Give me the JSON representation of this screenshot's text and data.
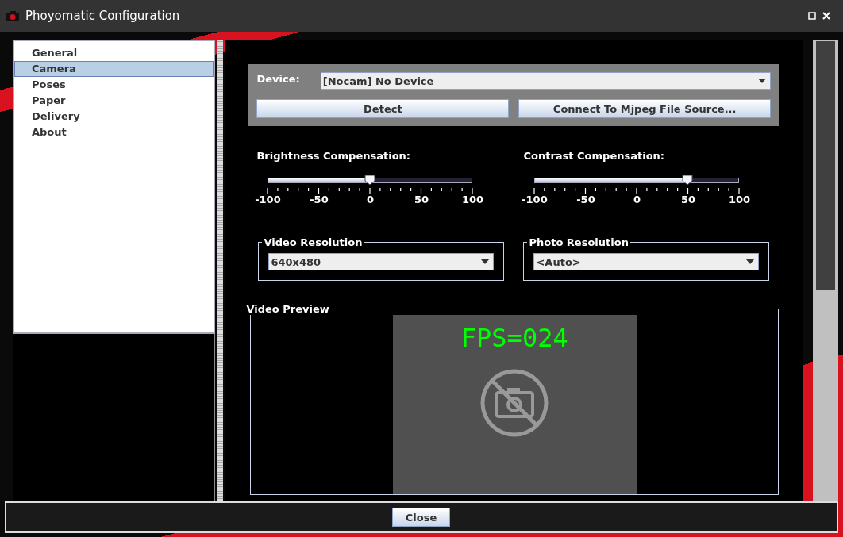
{
  "window": {
    "title": "Phoyomatic Configuration"
  },
  "sidebar": {
    "items": [
      {
        "label": "General",
        "selected": false
      },
      {
        "label": "Camera",
        "selected": true
      },
      {
        "label": "Poses",
        "selected": false
      },
      {
        "label": "Paper",
        "selected": false
      },
      {
        "label": "Delivery",
        "selected": false
      },
      {
        "label": "About",
        "selected": false
      }
    ]
  },
  "device": {
    "label": "Device:",
    "value": "[Nocam] No Device",
    "buttons": [
      "Detect",
      "Connect To Mjpeg File Source..."
    ]
  },
  "sliders": [
    {
      "label": "Brightness Compensation:",
      "level": 0.5,
      "ticks": [
        "-100",
        "-50",
        "0",
        "50",
        "100"
      ]
    },
    {
      "label": "Contrast Compensation:",
      "level": 0.75,
      "ticks": [
        "-100",
        "-50",
        "0",
        "50",
        "100"
      ]
    }
  ],
  "resolutions": [
    {
      "title": "Video Resolution",
      "value": "640x480"
    },
    {
      "title": "Photo Resolution",
      "value": "<Auto>"
    }
  ],
  "preview": {
    "title": "Video Preview",
    "fps": "FPS=024"
  },
  "footer": {
    "button": "Close"
  }
}
